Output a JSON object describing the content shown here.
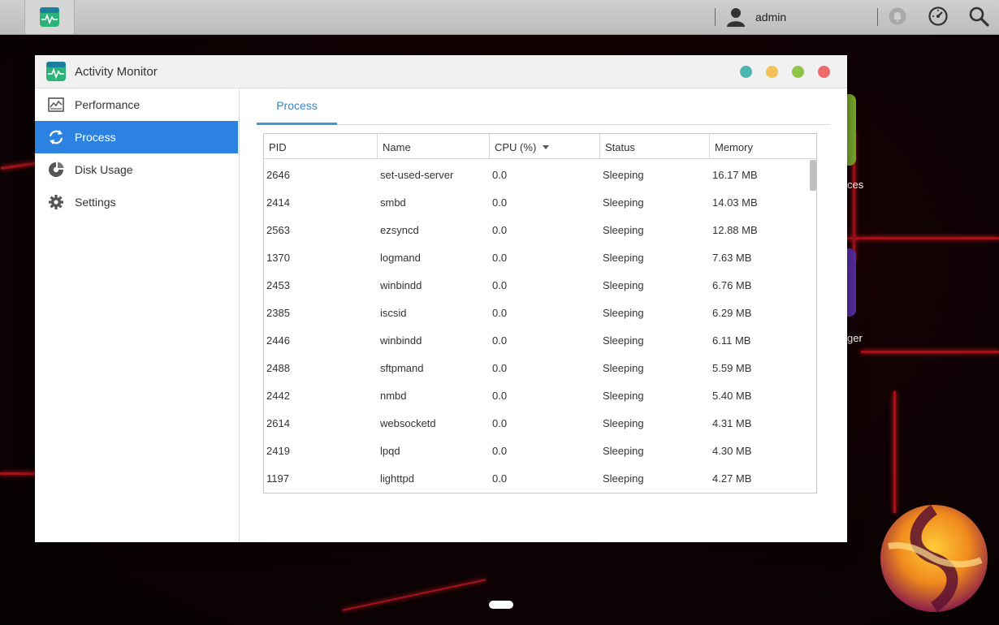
{
  "topbar": {
    "username": "admin"
  },
  "desktop": {
    "partial_label_1": "ces",
    "partial_label_2": "ger"
  },
  "window": {
    "title": "Activity Monitor",
    "buttons": {
      "help": "#4db6b0",
      "minimize": "#f2c15a",
      "maximize": "#8fc449",
      "close": "#ef6b6b"
    }
  },
  "sidebar": {
    "items": [
      {
        "label": "Performance",
        "icon": "chart-icon"
      },
      {
        "label": "Process",
        "icon": "refresh-icon"
      },
      {
        "label": "Disk Usage",
        "icon": "pie-icon"
      },
      {
        "label": "Settings",
        "icon": "gear-icon"
      }
    ],
    "active": "Process"
  },
  "tabs": {
    "process": "Process"
  },
  "table": {
    "columns": [
      "PID",
      "Name",
      "CPU (%)",
      "Status",
      "Memory"
    ],
    "sorted_column": "CPU (%)",
    "rows": [
      [
        "2646",
        "set-used-server",
        "0.0",
        "Sleeping",
        "16.17 MB"
      ],
      [
        "2414",
        "smbd",
        "0.0",
        "Sleeping",
        "14.03 MB"
      ],
      [
        "2563",
        "ezsyncd",
        "0.0",
        "Sleeping",
        "12.88 MB"
      ],
      [
        "1370",
        "logmand",
        "0.0",
        "Sleeping",
        "7.63 MB"
      ],
      [
        "2453",
        "winbindd",
        "0.0",
        "Sleeping",
        "6.76 MB"
      ],
      [
        "2385",
        "iscsid",
        "0.0",
        "Sleeping",
        "6.29 MB"
      ],
      [
        "2446",
        "winbindd",
        "0.0",
        "Sleeping",
        "6.11 MB"
      ],
      [
        "2488",
        "sftpmand",
        "0.0",
        "Sleeping",
        "5.59 MB"
      ],
      [
        "2442",
        "nmbd",
        "0.0",
        "Sleeping",
        "5.40 MB"
      ],
      [
        "2614",
        "websocketd",
        "0.0",
        "Sleeping",
        "4.31 MB"
      ],
      [
        "2419",
        "lpqd",
        "0.0",
        "Sleeping",
        "4.30 MB"
      ],
      [
        "1197",
        "lighttpd",
        "0.0",
        "Sleeping",
        "4.27 MB"
      ]
    ]
  }
}
